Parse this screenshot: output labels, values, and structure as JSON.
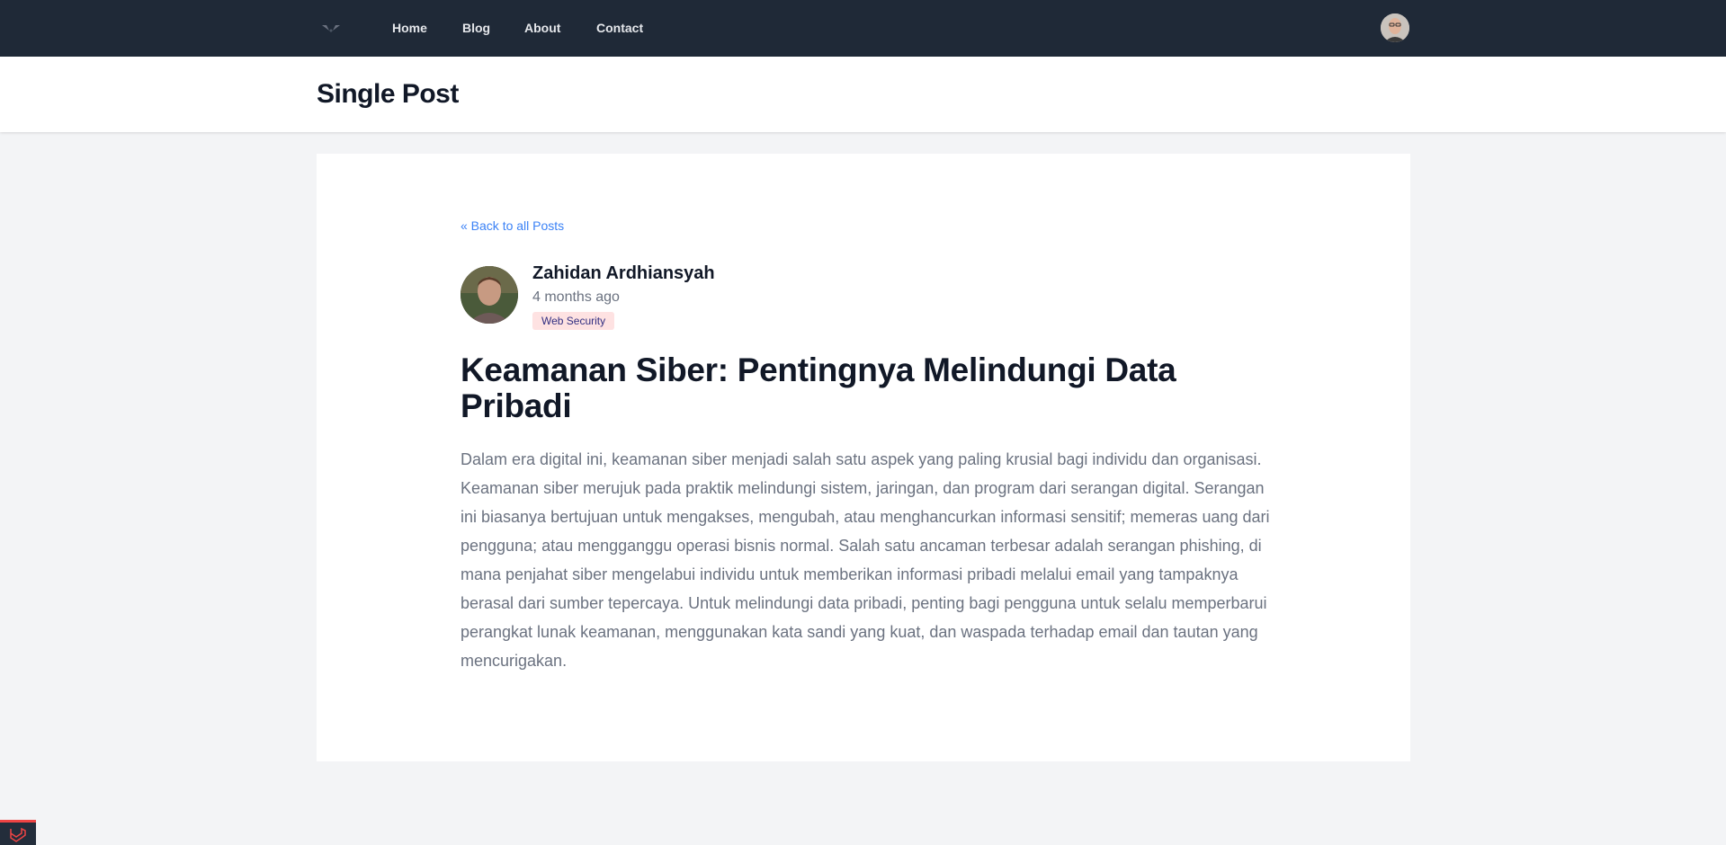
{
  "nav": {
    "logo_icon": "logo-icon",
    "links": [
      "Home",
      "Blog",
      "About",
      "Contact"
    ],
    "avatar_icon": "user-avatar"
  },
  "header": {
    "title": "Single Post"
  },
  "post": {
    "back_link": "« Back to all Posts",
    "author": "Zahidan Ardhiansyah",
    "time": "4 months ago",
    "category": "Web Security",
    "title": "Keamanan Siber: Pentingnya Melindungi Data Pribadi",
    "body": "Dalam era digital ini, keamanan siber menjadi salah satu aspek yang paling krusial bagi individu dan organisasi. Keamanan siber merujuk pada praktik melindungi sistem, jaringan, dan program dari serangan digital. Serangan ini biasanya bertujuan untuk mengakses, mengubah, atau menghancurkan informasi sensitif; memeras uang dari pengguna; atau mengganggu operasi bisnis normal. Salah satu ancaman terbesar adalah serangan phishing, di mana penjahat siber mengelabui individu untuk memberikan informasi pribadi melalui email yang tampaknya berasal dari sumber tepercaya. Untuk melindungi data pribadi, penting bagi pengguna untuk selalu memperbarui perangkat lunak keamanan, menggunakan kata sandi yang kuat, dan waspada terhadap email dan tautan yang mencurigakan."
  },
  "colors": {
    "nav_bg": "#1f2937",
    "link": "#3b82f6",
    "badge_bg": "#fee2e2",
    "badge_text": "#312e81",
    "page_bg": "#f3f4f6"
  },
  "debug_bar_icon": "laravel-icon"
}
